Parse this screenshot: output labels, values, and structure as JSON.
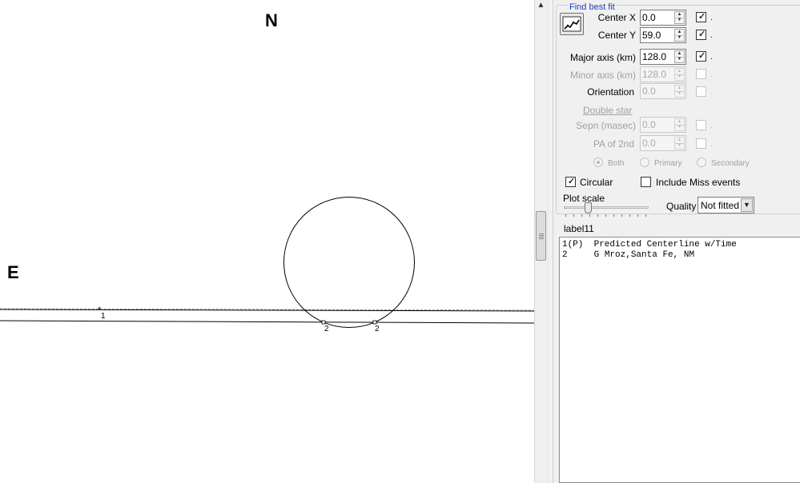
{
  "plot": {
    "compass_north": "N",
    "compass_east": "E",
    "chord_labels": {
      "chord1": "1",
      "chord2_start": "2",
      "chord2_end": "2"
    }
  },
  "fit_panel": {
    "group_title": "Find best fit",
    "fit_button_icon": "chart-fit-icon",
    "center_x": {
      "label": "Center X",
      "value": "0.0",
      "checked": true,
      "suffix": "."
    },
    "center_y": {
      "label": "Center Y",
      "value": "59.0",
      "checked": true,
      "suffix": "."
    },
    "major_axis": {
      "label": "Major axis (km)",
      "value": "128.0",
      "checked": true,
      "suffix": "."
    },
    "minor_axis": {
      "label": "Minor axis (km)",
      "value": "128.0",
      "checked": false,
      "suffix": "."
    },
    "orientation": {
      "label": "Orientation",
      "value": "0.0",
      "checked": false,
      "suffix": "."
    },
    "double_star_label": "Double star",
    "sepn": {
      "label": "Sepn (masec)",
      "value": "0.0",
      "checked": false,
      "suffix": "."
    },
    "pa_2nd": {
      "label": "PA of 2nd",
      "value": "0.0",
      "checked": false,
      "suffix": "."
    },
    "radios": {
      "both": "Both",
      "primary": "Primary",
      "secondary": "Secondary"
    },
    "circular": {
      "label": "Circular",
      "checked": true
    },
    "include_miss": {
      "label": "Include Miss events",
      "checked": false
    },
    "plot_scale_label": "Plot scale",
    "quality_label": "Quality",
    "quality_value": "Not fitted"
  },
  "status_label": "label11",
  "observer_list": [
    {
      "index": "1(P)",
      "name": "Predicted Centerline w/Time"
    },
    {
      "index": "2",
      "name": "G Mroz,Santa Fe, NM"
    }
  ]
}
